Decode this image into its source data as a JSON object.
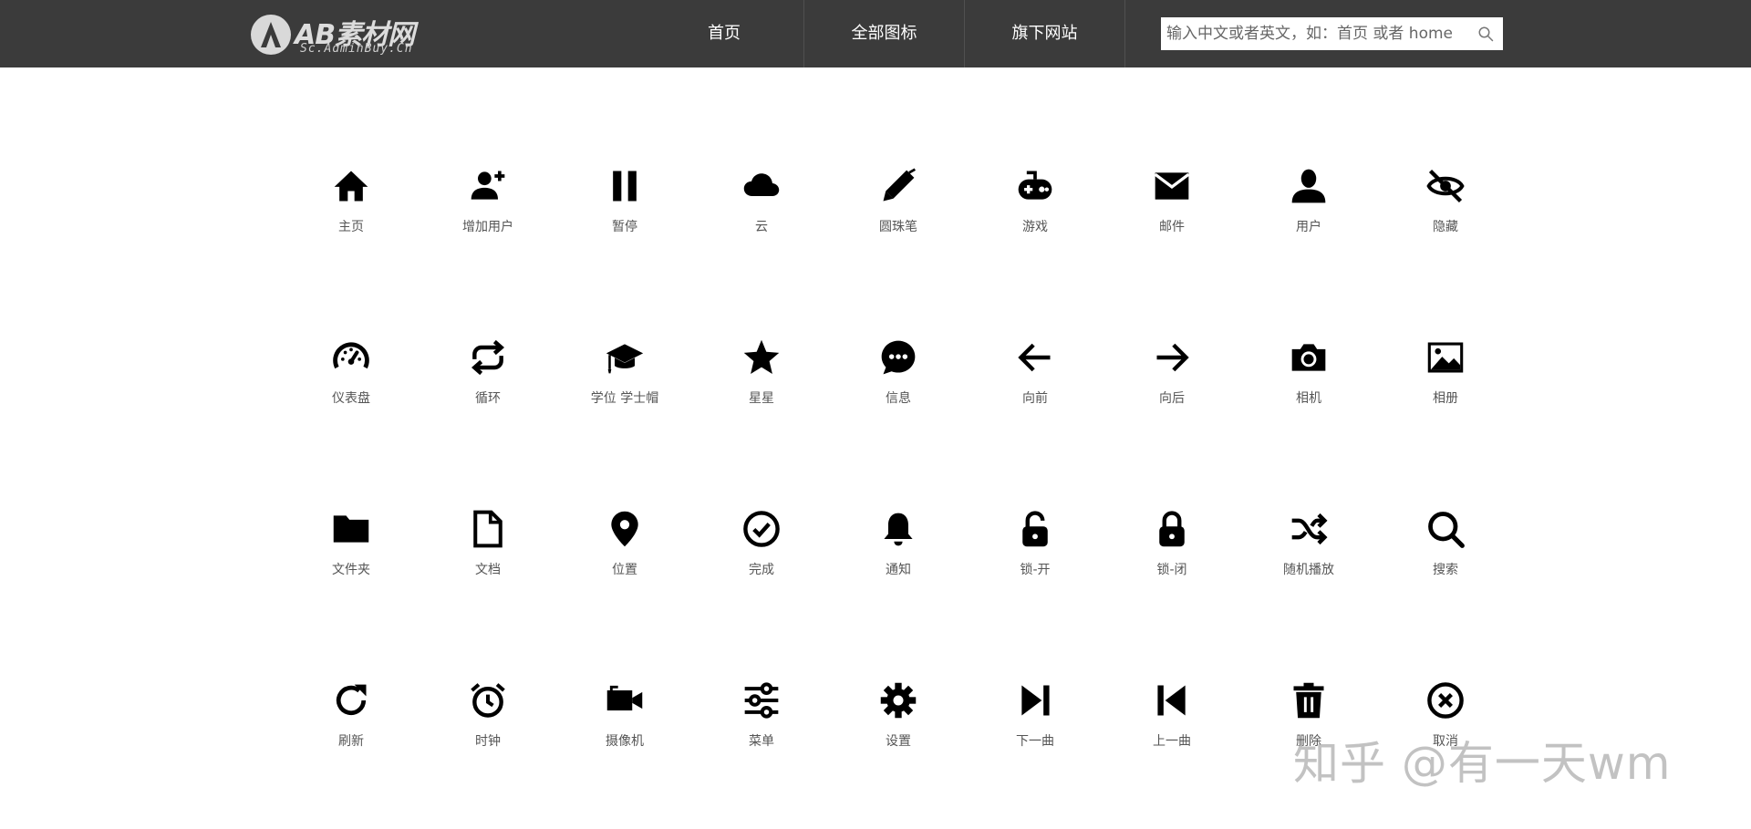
{
  "header": {
    "logo": {
      "main": "AB素材网",
      "sub": "Sc.AdminBuy.Cn"
    },
    "nav": [
      {
        "label": "首页"
      },
      {
        "label": "全部图标"
      },
      {
        "label": "旗下网站"
      }
    ],
    "search": {
      "placeholder": "输入中文或者英文，如：首页 或者 home",
      "icon": "search-icon"
    }
  },
  "icons": [
    {
      "name": "home-icon",
      "label": "主页"
    },
    {
      "name": "add-user-icon",
      "label": "增加用户"
    },
    {
      "name": "pause-icon",
      "label": "暂停"
    },
    {
      "name": "cloud-icon",
      "label": "云"
    },
    {
      "name": "pen-icon",
      "label": "圆珠笔"
    },
    {
      "name": "gamepad-icon",
      "label": "游戏"
    },
    {
      "name": "mail-icon",
      "label": "邮件"
    },
    {
      "name": "user-icon",
      "label": "用户"
    },
    {
      "name": "eye-off-icon",
      "label": "隐藏"
    },
    {
      "name": "dashboard-icon",
      "label": "仪表盘"
    },
    {
      "name": "repeat-icon",
      "label": "循环"
    },
    {
      "name": "graduation-cap-icon",
      "label": "学位 学士帽"
    },
    {
      "name": "star-icon",
      "label": "星星"
    },
    {
      "name": "chat-icon",
      "label": "信息"
    },
    {
      "name": "arrow-left-icon",
      "label": "向前"
    },
    {
      "name": "arrow-right-icon",
      "label": "向后"
    },
    {
      "name": "camera-icon",
      "label": "相机"
    },
    {
      "name": "image-icon",
      "label": "相册"
    },
    {
      "name": "folder-icon",
      "label": "文件夹"
    },
    {
      "name": "document-icon",
      "label": "文档"
    },
    {
      "name": "location-pin-icon",
      "label": "位置"
    },
    {
      "name": "check-circle-icon",
      "label": "完成"
    },
    {
      "name": "bell-icon",
      "label": "通知"
    },
    {
      "name": "lock-open-icon",
      "label": "锁-开"
    },
    {
      "name": "lock-closed-icon",
      "label": "锁-闭"
    },
    {
      "name": "shuffle-icon",
      "label": "随机播放"
    },
    {
      "name": "search-icon",
      "label": "搜索"
    },
    {
      "name": "refresh-icon",
      "label": "刷新"
    },
    {
      "name": "alarm-clock-icon",
      "label": "时钟"
    },
    {
      "name": "video-camera-icon",
      "label": "摄像机"
    },
    {
      "name": "sliders-icon",
      "label": "菜单"
    },
    {
      "name": "gear-icon",
      "label": "设置"
    },
    {
      "name": "skip-next-icon",
      "label": "下一曲"
    },
    {
      "name": "skip-previous-icon",
      "label": "上一曲"
    },
    {
      "name": "trash-icon",
      "label": "删除"
    },
    {
      "name": "close-circle-icon",
      "label": "取消"
    }
  ],
  "watermark": "知乎 @有一天wm"
}
